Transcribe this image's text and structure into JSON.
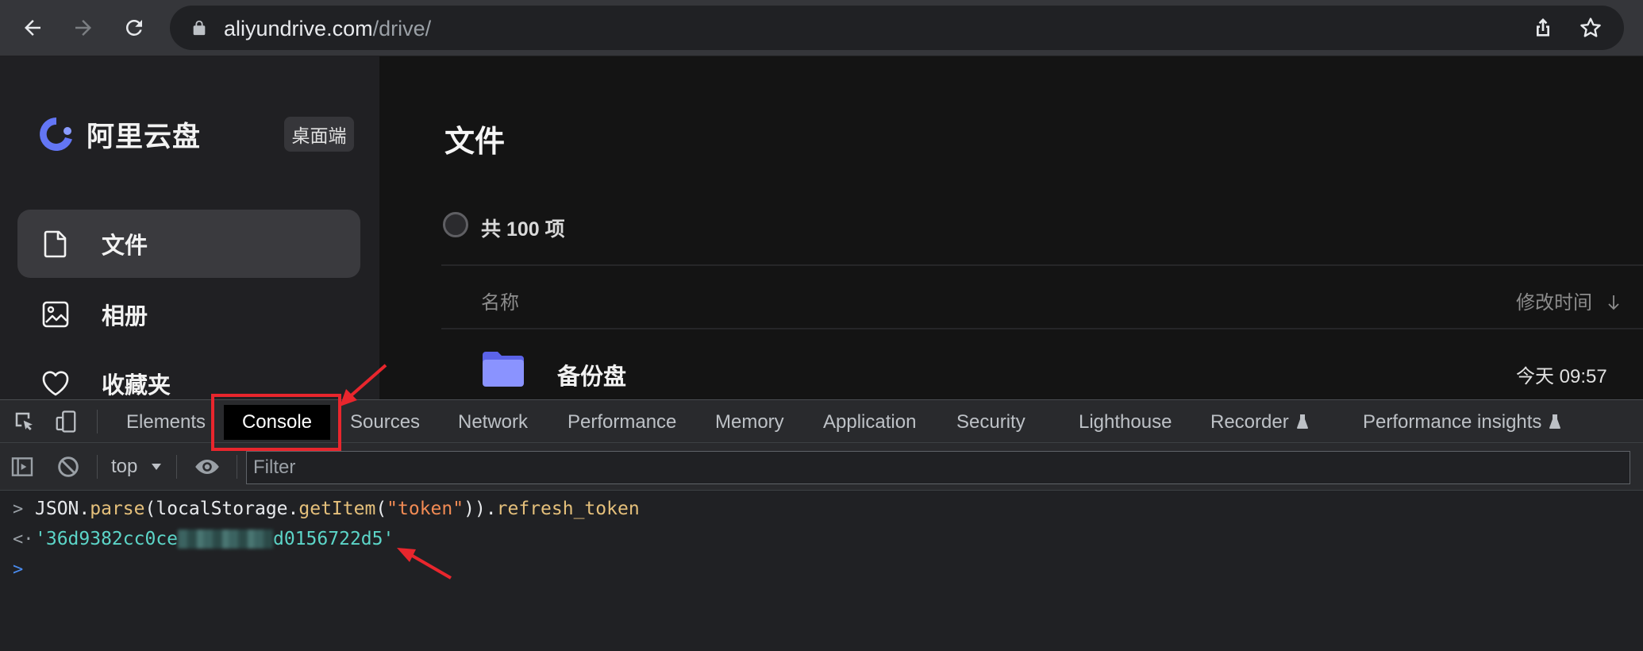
{
  "browser": {
    "back_icon": "arrow-left-icon",
    "forward_icon": "arrow-right-icon",
    "reload_icon": "reload-icon",
    "url_host": "aliyundrive.com",
    "url_path": "/drive/",
    "share_icon": "share-icon",
    "bookmark_icon": "star-icon"
  },
  "sidebar": {
    "brand_name": "阿里云盘",
    "desktop_button": "桌面端",
    "items": [
      {
        "label": "文件",
        "icon": "file-icon",
        "active": true
      },
      {
        "label": "相册",
        "icon": "photo-icon",
        "active": false
      },
      {
        "label": "收藏夹",
        "icon": "heart-icon",
        "active": false
      }
    ]
  },
  "main": {
    "title": "文件",
    "total": "共 100 项",
    "col_name": "名称",
    "col_mtime": "修改时间",
    "rows": [
      {
        "name": "备份盘",
        "time": "今天 09:57",
        "icon": "folder-icon"
      }
    ]
  },
  "devtools": {
    "tabs": [
      "Elements",
      "Console",
      "Sources",
      "Network",
      "Performance",
      "Memory",
      "Application",
      "Security",
      "Lighthouse",
      "Recorder",
      "Performance insights"
    ],
    "active_tab": "Console",
    "context": "top",
    "filter_placeholder": "Filter",
    "console": {
      "input": {
        "p1": "JSON.",
        "p2": "parse",
        "p3": "(localStorage.",
        "p4": "getItem",
        "p5": "(",
        "p6": "\"token\"",
        "p7": ")).",
        "p8": "refresh_token"
      },
      "output_start": "'36d9382cc0ce",
      "output_end": "d0156722d5'"
    }
  },
  "colors": {
    "annotation_red": "#e8262d",
    "brand_blue": "#6376f5"
  }
}
